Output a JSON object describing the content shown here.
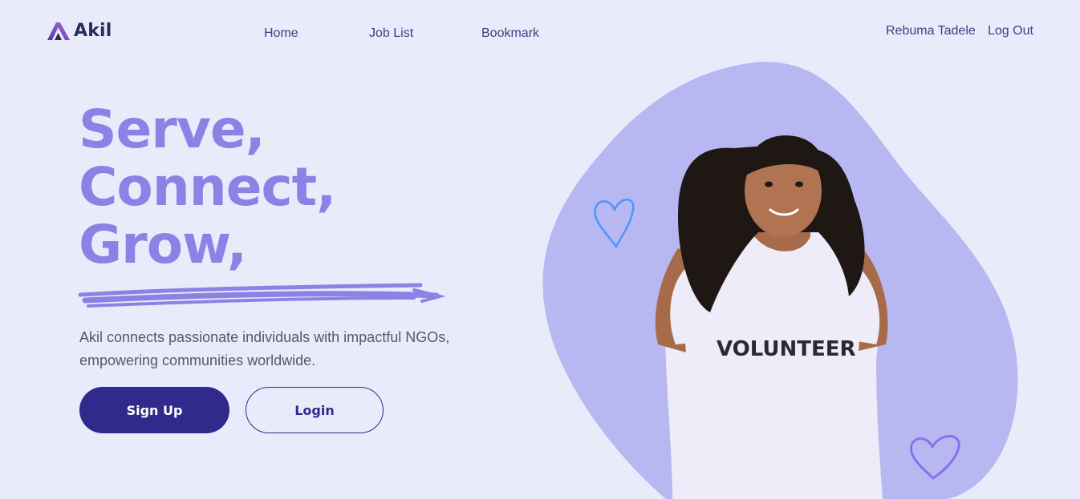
{
  "brand": {
    "name": "Akil",
    "colors": {
      "background": "#eaebfa",
      "accent": "#8a82e5",
      "primary": "#2f2a8c",
      "blob": "#b7b7f2",
      "heart_blue": "#4d96f7",
      "heart_purple": "#8a70ee"
    }
  },
  "nav": {
    "links": [
      "Home",
      "Job List",
      "Bookmark"
    ],
    "user_name": "Rebuma Tadele",
    "logout_label": "Log Out"
  },
  "hero": {
    "title_lines": [
      "Serve,",
      "Connect,",
      "Grow,"
    ],
    "description": "Akil connects passionate individuals with impactful NGOs, empowering communities worldwide.",
    "signup_label": "Sign Up",
    "login_label": "Login",
    "shirt_text": "VOLUNTEER"
  }
}
